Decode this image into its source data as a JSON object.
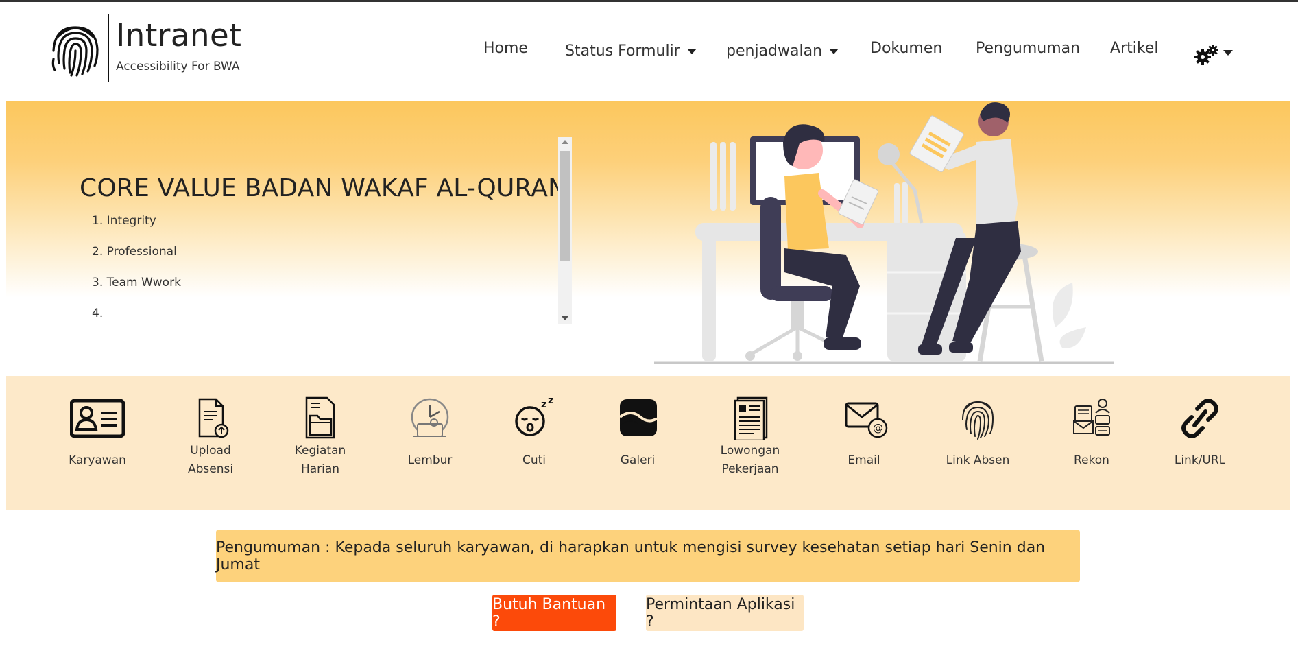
{
  "brand": {
    "title": "Intranet",
    "subtitle": "Accessibility For BWA",
    "logo_icon": "fingerprint-icon"
  },
  "nav": {
    "items": [
      {
        "label": "Home",
        "dropdown": false
      },
      {
        "label": "Status Formulir",
        "dropdown": true
      },
      {
        "label": "penjadwalan",
        "dropdown": true
      },
      {
        "label": "Dokumen",
        "dropdown": false
      },
      {
        "label": "Pengumuman",
        "dropdown": false
      },
      {
        "label": "Artikel",
        "dropdown": false
      }
    ],
    "settings_icon": "gears-icon"
  },
  "hero": {
    "title": "CORE VALUE BADAN WAKAF AL-QURAN",
    "values": [
      "1. Integrity",
      "2. Professional",
      "3. Team Wwork",
      "4."
    ],
    "illustration": "office-meeting-illustration"
  },
  "menu": {
    "items": [
      {
        "label": "Karyawan",
        "icon": "id-card-icon"
      },
      {
        "label": "Upload Absensi",
        "icon": "file-upload-icon"
      },
      {
        "label": "Kegiatan Harian",
        "icon": "folder-document-icon"
      },
      {
        "label": "Lembur",
        "icon": "overtime-clock-icon"
      },
      {
        "label": "Cuti",
        "icon": "sleep-face-icon"
      },
      {
        "label": "Galeri",
        "icon": "image-gallery-icon"
      },
      {
        "label": "Lowongan Pekerjaan",
        "icon": "job-document-icon"
      },
      {
        "label": "Email",
        "icon": "email-at-icon"
      },
      {
        "label": "Link Absen",
        "icon": "fingerprint-icon"
      },
      {
        "label": "Rekon",
        "icon": "reconciliation-icon"
      },
      {
        "label": "Link/URL",
        "icon": "link-chain-icon"
      }
    ]
  },
  "announcement": {
    "text": "Pengumuman : Kepada seluruh karyawan, di harapkan untuk mengisi survey kesehatan setiap hari Senin dan Jumat"
  },
  "buttons": {
    "help": "Butuh Bantuan ?",
    "request": "Permintaan Aplikasi ?"
  },
  "colors": {
    "hero_top": "#fcc75d",
    "menu_bg": "#fde9c9",
    "announcement_bg": "#fdd27c",
    "help_button": "#fc4a0a",
    "request_button": "#fde6c4"
  }
}
